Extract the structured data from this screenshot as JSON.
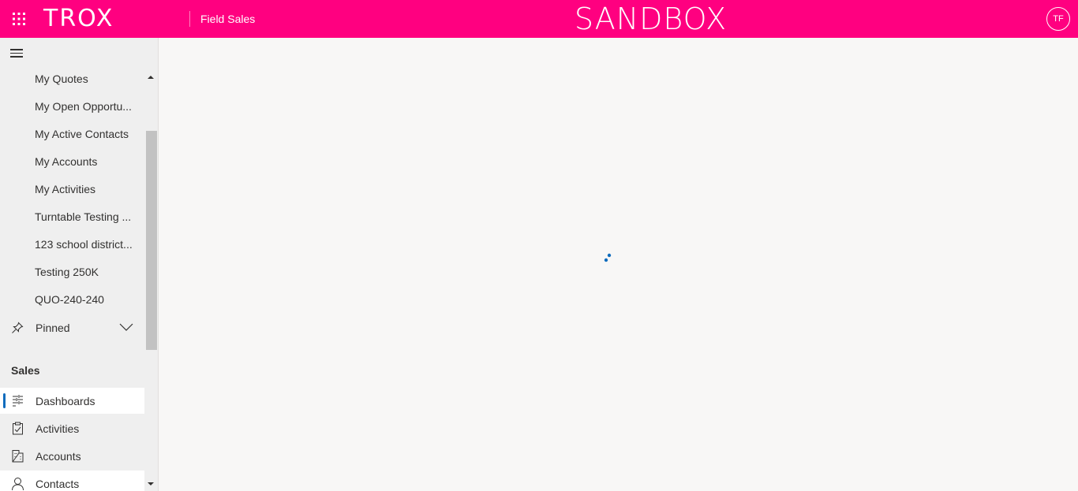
{
  "header": {
    "logo": "TROX",
    "app_name": "Field Sales",
    "environment": "SANDBOX",
    "user_initials": "TF",
    "brand_color": "#ff0080"
  },
  "sidebar": {
    "recent_items": [
      "My Quotes",
      "My Open Opportu...",
      "My Active Contacts",
      "My Accounts",
      "My Activities",
      "Turntable Testing ...",
      "123 school district...",
      "Testing 250K",
      "QUO-240-240"
    ],
    "pinned_label": "Pinned",
    "group_title": "Sales",
    "nav_items": [
      {
        "label": "Dashboards",
        "icon": "dashboard-icon",
        "selected": true
      },
      {
        "label": "Activities",
        "icon": "clipboard-icon",
        "selected": false
      },
      {
        "label": "Accounts",
        "icon": "building-icon",
        "selected": false
      },
      {
        "label": "Contacts",
        "icon": "person-icon",
        "selected": false
      }
    ]
  },
  "main": {
    "state": "loading",
    "accent_color": "#0f6cbd"
  }
}
